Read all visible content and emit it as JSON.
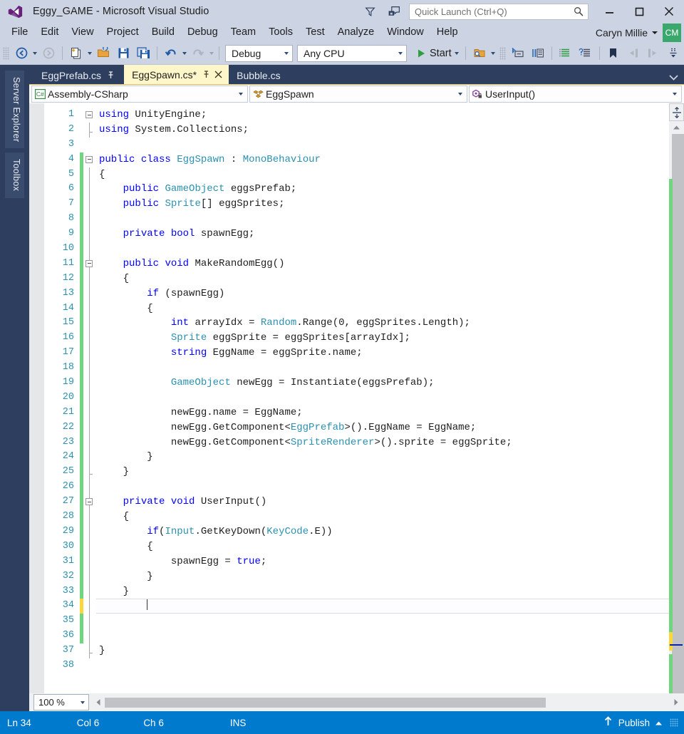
{
  "window": {
    "title": "Eggy_GAME - Microsoft Visual Studio",
    "logo_icon": "visual-studio-logo",
    "minimize_icon": "minimize-icon",
    "maximize_icon": "maximize-icon",
    "close_icon": "close-icon",
    "feedback_icon": "feedback-icon",
    "filter_icon": "filter-icon"
  },
  "quick_launch": {
    "placeholder": "Quick Launch (Ctrl+Q)",
    "search_icon": "search-icon"
  },
  "menu": {
    "items": [
      {
        "label": "File"
      },
      {
        "label": "Edit"
      },
      {
        "label": "View"
      },
      {
        "label": "Project"
      },
      {
        "label": "Build"
      },
      {
        "label": "Debug"
      },
      {
        "label": "Team"
      },
      {
        "label": "Tools"
      },
      {
        "label": "Test"
      },
      {
        "label": "Analyze"
      },
      {
        "label": "Window"
      },
      {
        "label": "Help"
      }
    ]
  },
  "account": {
    "name": "Caryn Millie",
    "initials": "CM",
    "avatar_color": "#3aa76d"
  },
  "toolbar": {
    "navigate_back_icon": "navigate-back-icon",
    "navigate_forward_icon": "navigate-forward-icon",
    "new_item_icon": "new-item-icon",
    "open_file_icon": "open-file-icon",
    "save_icon": "save-icon",
    "save_all_icon": "save-all-icon",
    "undo_icon": "undo-icon",
    "redo_icon": "redo-icon",
    "config_value": "Debug",
    "platform_value": "Any CPU",
    "start_label": "Start",
    "start_icon": "play-icon",
    "find_in_files_icon": "find-in-files-icon",
    "step_into_icon": "step-into-icon",
    "comment_icon": "comment-selection-icon",
    "uncomment_icon": "uncomment-selection-icon",
    "indent_icon": "increase-indent-icon",
    "outdent_icon": "decrease-indent-icon",
    "bookmark_icon": "bookmark-icon",
    "prev_bookmark_icon": "previous-bookmark-icon",
    "next_bookmark_icon": "next-bookmark-icon",
    "overflow_icon": "toolbar-overflow-icon"
  },
  "left_dock": {
    "tabs": [
      {
        "label": "Server Explorer"
      },
      {
        "label": "Toolbox"
      }
    ]
  },
  "document_tabs": {
    "tabs": [
      {
        "label": "EggPrefab.cs",
        "active": false,
        "pinned": true,
        "closable": false
      },
      {
        "label": "EggSpawn.cs*",
        "active": true,
        "pinned": true,
        "closable": true
      },
      {
        "label": "Bubble.cs",
        "active": false,
        "pinned": false,
        "closable": false
      }
    ],
    "pin_icon": "pin-icon",
    "close_icon": "close-icon",
    "overflow_icon": "tab-list-chevron-down-icon"
  },
  "nav_bar": {
    "project": {
      "value": "Assembly-CSharp",
      "icon": "csharp-project-icon"
    },
    "type": {
      "value": "EggSpawn",
      "icon": "class-icon"
    },
    "member": {
      "value": "UserInput()",
      "icon": "private-method-icon"
    },
    "dropdown_icon": "chevron-down-icon"
  },
  "editor": {
    "first_line": 1,
    "last_line": 38,
    "current_line": 34,
    "lines": [
      {
        "n": 1,
        "text": "using UnityEngine;",
        "tokens": [
          {
            "t": "using",
            "c": "kw"
          },
          {
            "t": " UnityEngine;",
            "c": ""
          }
        ],
        "change": "none",
        "fold": "open",
        "foldline": "none"
      },
      {
        "n": 2,
        "text": "using System.Collections;",
        "tokens": [
          {
            "t": "using",
            "c": "dimkw"
          },
          {
            "t": " System.Collections;",
            "c": "dim"
          }
        ],
        "change": "none",
        "fold": "none",
        "foldline": "end"
      },
      {
        "n": 3,
        "text": "",
        "tokens": [],
        "change": "none",
        "fold": "none",
        "foldline": "none"
      },
      {
        "n": 4,
        "text": "public class EggSpawn : MonoBehaviour",
        "tokens": [
          {
            "t": "public",
            "c": "kw"
          },
          {
            "t": " ",
            "c": ""
          },
          {
            "t": "class",
            "c": "kw"
          },
          {
            "t": " ",
            "c": ""
          },
          {
            "t": "EggSpawn",
            "c": "typ"
          },
          {
            "t": " : ",
            "c": ""
          },
          {
            "t": "MonoBehaviour",
            "c": "typ"
          }
        ],
        "change": "green",
        "fold": "open",
        "foldline": "none"
      },
      {
        "n": 5,
        "text": "{",
        "tokens": [
          {
            "t": "{",
            "c": ""
          }
        ],
        "change": "green",
        "fold": "none",
        "foldline": "line"
      },
      {
        "n": 6,
        "text": "    public GameObject eggsPrefab;",
        "tokens": [
          {
            "t": "    ",
            "c": ""
          },
          {
            "t": "public",
            "c": "kw"
          },
          {
            "t": " ",
            "c": ""
          },
          {
            "t": "GameObject",
            "c": "typ"
          },
          {
            "t": " eggsPrefab;",
            "c": ""
          }
        ],
        "change": "green",
        "fold": "none",
        "foldline": "line"
      },
      {
        "n": 7,
        "text": "    public Sprite[] eggSprites;",
        "tokens": [
          {
            "t": "    ",
            "c": ""
          },
          {
            "t": "public",
            "c": "kw"
          },
          {
            "t": " ",
            "c": ""
          },
          {
            "t": "Sprite",
            "c": "typ"
          },
          {
            "t": "[] eggSprites;",
            "c": ""
          }
        ],
        "change": "green",
        "fold": "none",
        "foldline": "line"
      },
      {
        "n": 8,
        "text": "",
        "tokens": [],
        "change": "green",
        "fold": "none",
        "foldline": "line"
      },
      {
        "n": 9,
        "text": "    private bool spawnEgg;",
        "tokens": [
          {
            "t": "    ",
            "c": ""
          },
          {
            "t": "private",
            "c": "kw"
          },
          {
            "t": " ",
            "c": ""
          },
          {
            "t": "bool",
            "c": "kw"
          },
          {
            "t": " spawnEgg;",
            "c": ""
          }
        ],
        "change": "green",
        "fold": "none",
        "foldline": "line"
      },
      {
        "n": 10,
        "text": "",
        "tokens": [],
        "change": "green",
        "fold": "none",
        "foldline": "line"
      },
      {
        "n": 11,
        "text": "    public void MakeRandomEgg()",
        "tokens": [
          {
            "t": "    ",
            "c": ""
          },
          {
            "t": "public",
            "c": "kw"
          },
          {
            "t": " ",
            "c": ""
          },
          {
            "t": "void",
            "c": "kw"
          },
          {
            "t": " MakeRandomEgg()",
            "c": ""
          }
        ],
        "change": "green",
        "fold": "open",
        "foldline": "line"
      },
      {
        "n": 12,
        "text": "    {",
        "tokens": [
          {
            "t": "    {",
            "c": ""
          }
        ],
        "change": "green",
        "fold": "none",
        "foldline": "line"
      },
      {
        "n": 13,
        "text": "        if (spawnEgg)",
        "tokens": [
          {
            "t": "        ",
            "c": ""
          },
          {
            "t": "if",
            "c": "kw"
          },
          {
            "t": " (spawnEgg)",
            "c": ""
          }
        ],
        "change": "green",
        "fold": "none",
        "foldline": "line"
      },
      {
        "n": 14,
        "text": "        {",
        "tokens": [
          {
            "t": "        {",
            "c": ""
          }
        ],
        "change": "green",
        "fold": "none",
        "foldline": "line"
      },
      {
        "n": 15,
        "text": "            int arrayIdx = Random.Range(0, eggSprites.Length);",
        "tokens": [
          {
            "t": "            ",
            "c": ""
          },
          {
            "t": "int",
            "c": "kw"
          },
          {
            "t": " arrayIdx = ",
            "c": ""
          },
          {
            "t": "Random",
            "c": "typ"
          },
          {
            "t": ".Range(0, eggSprites.Length);",
            "c": ""
          }
        ],
        "change": "green",
        "fold": "none",
        "foldline": "line"
      },
      {
        "n": 16,
        "text": "            Sprite eggSprite = eggSprites[arrayIdx];",
        "tokens": [
          {
            "t": "            ",
            "c": ""
          },
          {
            "t": "Sprite",
            "c": "typ"
          },
          {
            "t": " eggSprite = eggSprites[arrayIdx];",
            "c": ""
          }
        ],
        "change": "green",
        "fold": "none",
        "foldline": "line"
      },
      {
        "n": 17,
        "text": "            string EggName = eggSprite.name;",
        "tokens": [
          {
            "t": "            ",
            "c": ""
          },
          {
            "t": "string",
            "c": "kw"
          },
          {
            "t": " EggName = eggSprite.name;",
            "c": ""
          }
        ],
        "change": "green",
        "fold": "none",
        "foldline": "line"
      },
      {
        "n": 18,
        "text": "",
        "tokens": [],
        "change": "green",
        "fold": "none",
        "foldline": "line"
      },
      {
        "n": 19,
        "text": "            GameObject newEgg = Instantiate(eggsPrefab);",
        "tokens": [
          {
            "t": "            ",
            "c": ""
          },
          {
            "t": "GameObject",
            "c": "typ"
          },
          {
            "t": " newEgg = Instantiate(eggsPrefab);",
            "c": ""
          }
        ],
        "change": "green",
        "fold": "none",
        "foldline": "line"
      },
      {
        "n": 20,
        "text": "",
        "tokens": [],
        "change": "green",
        "fold": "none",
        "foldline": "line"
      },
      {
        "n": 21,
        "text": "            newEgg.name = EggName;",
        "tokens": [
          {
            "t": "            newEgg.name = EggName;",
            "c": ""
          }
        ],
        "change": "green",
        "fold": "none",
        "foldline": "line"
      },
      {
        "n": 22,
        "text": "            newEgg.GetComponent<EggPrefab>().EggName = EggName;",
        "tokens": [
          {
            "t": "            newEgg.GetComponent<",
            "c": ""
          },
          {
            "t": "EggPrefab",
            "c": "typ"
          },
          {
            "t": ">().EggName = EggName;",
            "c": ""
          }
        ],
        "change": "green",
        "fold": "none",
        "foldline": "line"
      },
      {
        "n": 23,
        "text": "            newEgg.GetComponent<SpriteRenderer>().sprite = eggSprite;",
        "tokens": [
          {
            "t": "            newEgg.GetComponent<",
            "c": ""
          },
          {
            "t": "SpriteRenderer",
            "c": "typ"
          },
          {
            "t": ">().sprite = eggSprite;",
            "c": ""
          }
        ],
        "change": "green",
        "fold": "none",
        "foldline": "line"
      },
      {
        "n": 24,
        "text": "        }",
        "tokens": [
          {
            "t": "        }",
            "c": ""
          }
        ],
        "change": "green",
        "fold": "none",
        "foldline": "line"
      },
      {
        "n": 25,
        "text": "    }",
        "tokens": [
          {
            "t": "    }",
            "c": ""
          }
        ],
        "change": "green",
        "fold": "none",
        "foldline": "endline"
      },
      {
        "n": 26,
        "text": "",
        "tokens": [],
        "change": "green",
        "fold": "none",
        "foldline": "line"
      },
      {
        "n": 27,
        "text": "    private void UserInput()",
        "tokens": [
          {
            "t": "    ",
            "c": ""
          },
          {
            "t": "private",
            "c": "kw"
          },
          {
            "t": " ",
            "c": ""
          },
          {
            "t": "void",
            "c": "kw"
          },
          {
            "t": " UserInput()",
            "c": ""
          }
        ],
        "change": "green",
        "fold": "open",
        "foldline": "line"
      },
      {
        "n": 28,
        "text": "    {",
        "tokens": [
          {
            "t": "    {",
            "c": ""
          }
        ],
        "change": "green",
        "fold": "none",
        "foldline": "line"
      },
      {
        "n": 29,
        "text": "        if(Input.GetKeyDown(KeyCode.E))",
        "tokens": [
          {
            "t": "        ",
            "c": ""
          },
          {
            "t": "if",
            "c": "kw"
          },
          {
            "t": "(",
            "c": ""
          },
          {
            "t": "Input",
            "c": "typ"
          },
          {
            "t": ".GetKeyDown(",
            "c": ""
          },
          {
            "t": "KeyCode",
            "c": "typ"
          },
          {
            "t": ".E))",
            "c": ""
          }
        ],
        "change": "green",
        "fold": "none",
        "foldline": "line"
      },
      {
        "n": 30,
        "text": "        {",
        "tokens": [
          {
            "t": "        {",
            "c": ""
          }
        ],
        "change": "green",
        "fold": "none",
        "foldline": "line"
      },
      {
        "n": 31,
        "text": "            spawnEgg = true;",
        "tokens": [
          {
            "t": "            spawnEgg = ",
            "c": ""
          },
          {
            "t": "true",
            "c": "kw"
          },
          {
            "t": ";",
            "c": ""
          }
        ],
        "change": "green",
        "fold": "none",
        "foldline": "line"
      },
      {
        "n": 32,
        "text": "        }",
        "tokens": [
          {
            "t": "        }",
            "c": ""
          }
        ],
        "change": "green",
        "fold": "none",
        "foldline": "line"
      },
      {
        "n": 33,
        "text": "    }",
        "tokens": [
          {
            "t": "    }",
            "c": ""
          }
        ],
        "change": "green",
        "fold": "none",
        "foldline": "line"
      },
      {
        "n": 34,
        "text": "",
        "tokens": [],
        "change": "yellow",
        "fold": "none",
        "foldline": "line",
        "caret": true
      },
      {
        "n": 35,
        "text": "",
        "tokens": [],
        "change": "green",
        "fold": "none",
        "foldline": "line"
      },
      {
        "n": 36,
        "text": "",
        "tokens": [],
        "change": "green",
        "fold": "none",
        "foldline": "line"
      },
      {
        "n": 37,
        "text": "}",
        "tokens": [
          {
            "t": "}",
            "c": ""
          }
        ],
        "change": "none",
        "fold": "none",
        "foldline": "endline"
      },
      {
        "n": 38,
        "text": "",
        "tokens": [],
        "change": "none",
        "fold": "none",
        "foldline": "none"
      }
    ]
  },
  "scrollbar": {
    "split_icon": "split-view-icon",
    "up_arrow_icon": "scroll-up-arrow-icon",
    "down_arrow_icon": "scroll-down-arrow-icon",
    "change_marker_color": "#6fd67f",
    "pending_marker_color": "#fad83b",
    "caret_marker_color": "#0b22a8"
  },
  "editor_bottom": {
    "zoom_value": "100 %",
    "zoom_arrow_icon": "chevron-down-icon",
    "hscroll_left_icon": "scroll-left-arrow-icon",
    "hscroll_right_icon": "scroll-right-arrow-icon"
  },
  "status_bar": {
    "line": "Ln 34",
    "column": "Col 6",
    "character": "Ch 6",
    "insert_mode": "INS",
    "publish_label": "Publish",
    "publish_icon": "upload-arrow-icon",
    "publish_chevron_icon": "chevron-up-icon",
    "background_color": "#007acc"
  }
}
